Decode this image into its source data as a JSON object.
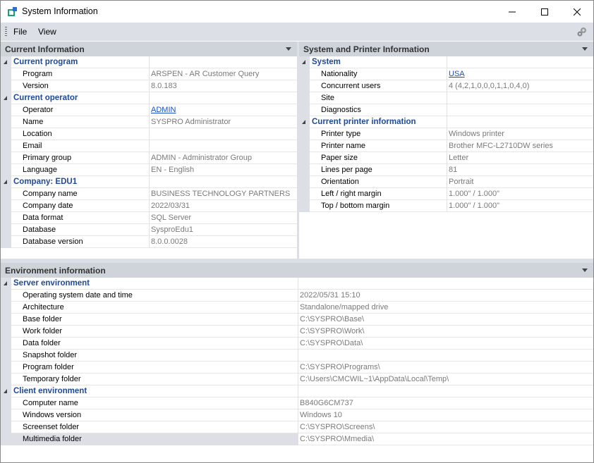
{
  "window": {
    "title": "System Information",
    "minimize": "minimize",
    "maximize": "maximize",
    "close": "close"
  },
  "menu": {
    "file": "File",
    "view": "View"
  },
  "current_info": {
    "header": "Current Information",
    "rows": [
      {
        "type": "cat",
        "label": "Current program"
      },
      {
        "type": "prop",
        "name": "Program",
        "value": "ARSPEN - AR Customer Query"
      },
      {
        "type": "prop",
        "name": "Version",
        "value": "8.0.183"
      },
      {
        "type": "cat",
        "label": "Current operator"
      },
      {
        "type": "prop",
        "name": "Operator",
        "value": "ADMIN",
        "link": true
      },
      {
        "type": "prop",
        "name": "Name",
        "value": "SYSPRO Administrator"
      },
      {
        "type": "prop",
        "name": "Location",
        "value": ""
      },
      {
        "type": "prop",
        "name": "Email",
        "value": ""
      },
      {
        "type": "prop",
        "name": "Primary group",
        "value": "ADMIN  - Administrator Group"
      },
      {
        "type": "prop",
        "name": "Language",
        "value": "EN - English"
      },
      {
        "type": "cat",
        "label": "Company: EDU1"
      },
      {
        "type": "prop",
        "name": "Company name",
        "value": "BUSINESS TECHNOLOGY PARTNERS"
      },
      {
        "type": "prop",
        "name": "Company date",
        "value": "2022/03/31"
      },
      {
        "type": "prop",
        "name": "Data format",
        "value": "SQL Server"
      },
      {
        "type": "prop",
        "name": "Database",
        "value": "SysproEdu1"
      },
      {
        "type": "prop",
        "name": "Database version",
        "value": "8.0.0.0028"
      }
    ]
  },
  "system_printer": {
    "header": "System and Printer Information",
    "rows": [
      {
        "type": "cat",
        "label": "System"
      },
      {
        "type": "prop",
        "name": "Nationality",
        "value": "USA",
        "link": true
      },
      {
        "type": "prop",
        "name": "Concurrent users",
        "value": "4 (4,2,1,0,0,0,1,1,0,4,0)"
      },
      {
        "type": "prop",
        "name": "Site",
        "value": ""
      },
      {
        "type": "prop",
        "name": "Diagnostics",
        "value": ""
      },
      {
        "type": "cat",
        "label": "Current printer information"
      },
      {
        "type": "prop",
        "name": "Printer type",
        "value": "Windows printer"
      },
      {
        "type": "prop",
        "name": "Printer name",
        "value": "Brother MFC-L2710DW series"
      },
      {
        "type": "prop",
        "name": "Paper size",
        "value": "Letter"
      },
      {
        "type": "prop",
        "name": "Lines per page",
        "value": "81"
      },
      {
        "type": "prop",
        "name": "Orientation",
        "value": "Portrait"
      },
      {
        "type": "prop",
        "name": "Left / right margin",
        "value": " 1.000\"  /  1.000\""
      },
      {
        "type": "prop",
        "name": "Top / bottom margin",
        "value": " 1.000\"  /  1.000\""
      }
    ]
  },
  "environment": {
    "header": "Environment information",
    "rows": [
      {
        "type": "cat",
        "label": "Server environment"
      },
      {
        "type": "prop",
        "name": "Operating system date and time",
        "value": "2022/05/31 15:10"
      },
      {
        "type": "prop",
        "name": "Architecture",
        "value": "Standalone/mapped drive"
      },
      {
        "type": "prop",
        "name": "Base folder",
        "value": "C:\\SYSPRO\\Base\\"
      },
      {
        "type": "prop",
        "name": "Work folder",
        "value": "C:\\SYSPRO\\Work\\"
      },
      {
        "type": "prop",
        "name": "Data folder",
        "value": "C:\\SYSPRO\\Data\\"
      },
      {
        "type": "prop",
        "name": "Snapshot folder",
        "value": ""
      },
      {
        "type": "prop",
        "name": "Program folder",
        "value": "C:\\SYSPRO\\Programs\\"
      },
      {
        "type": "prop",
        "name": "Temporary folder",
        "value": "C:\\Users\\CMCWIL~1\\AppData\\Local\\Temp\\"
      },
      {
        "type": "cat",
        "label": "Client environment"
      },
      {
        "type": "prop",
        "name": "Computer name",
        "value": "B840G6CM737"
      },
      {
        "type": "prop",
        "name": "Windows version",
        "value": "Windows 10"
      },
      {
        "type": "prop",
        "name": "Screenset folder",
        "value": "C:\\SYSPRO\\Screens\\"
      },
      {
        "type": "prop",
        "name": "Multimedia folder",
        "value": "C:\\SYSPRO\\Mmedia\\",
        "selected": true
      }
    ]
  }
}
